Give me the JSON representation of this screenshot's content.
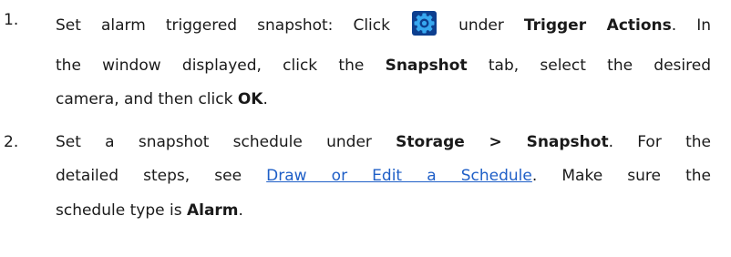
{
  "steps": [
    {
      "number": "1.",
      "line1_a": "Set alarm triggered snapshot: Click",
      "line1_b": "under",
      "line1_bold": "Trigger Actions",
      "line1_c": ". In",
      "line2_a": "the window displayed, click the",
      "line2_bold": "Snapshot",
      "line2_b": "tab, select the desired",
      "line3_a": "camera, and then click",
      "line3_bold": "OK",
      "line3_b": ".",
      "icon": "gear-settings-icon"
    },
    {
      "number": "2.",
      "line1_a": "Set a snapshot schedule under",
      "line1_bold": "Storage > Snapshot",
      "line1_b": ". For the",
      "line2_a": "detailed steps, see",
      "line2_link": "Draw or Edit a Schedule",
      "line2_b": ". Make sure the",
      "line3_a": "schedule type is",
      "line3_bold": "Alarm",
      "line3_b": "."
    }
  ],
  "colors": {
    "link": "#1f5fc7",
    "icon_bg": "#0d3f8f",
    "icon_fg": "#37a8f0"
  }
}
